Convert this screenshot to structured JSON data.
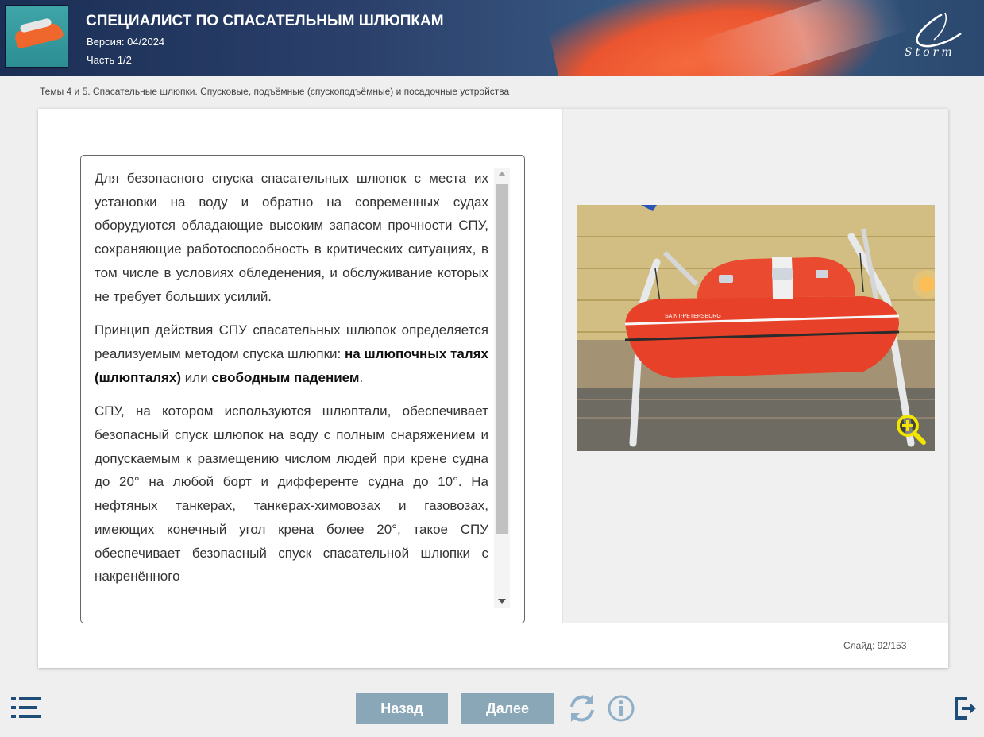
{
  "header": {
    "course_title": "СПЕЦИАЛИСТ ПО СПАСАТЕЛЬНЫМ ШЛЮПКАМ",
    "version": "Версия: 04/2024",
    "part": "Часть 1/2",
    "logo_text": "Storm"
  },
  "topic": "Темы 4 и 5. Спасательные шлюпки. Спусковые, подъёмные (спускоподъёмные) и посадочные устройства",
  "content": {
    "p1": "Для безопасного спуска спасательных шлюпок с места их установки на воду и обратно на современных судах оборудуются обладающие высоким запасом прочности СПУ, сохраняющие работоспособность в критических ситуациях, в том числе в условиях обледенения, и обслуживание которых не требует больших усилий.",
    "p2_start": "Принцип действия СПУ спасательных шлюпок определяется реализуемым методом спуска шлюпки: ",
    "p2_bold1": "на шлюпочных талях (шлюпталях)",
    "p2_mid": " или ",
    "p2_bold2": "свободным падением",
    "p2_end": ".",
    "p3": "СПУ, на котором используются шлюптали, обеспечивает безопасный спуск шлюпок на воду с полным снаряжением и допускаемым к размещению числом людей при крене судна до 20° на любой борт и дифференте судна до 10°. На нефтяных танкерах, танкерах-химовозах и газовозах, имеющих конечный угол крена более 20°, такое СПУ обеспечивает безопасный спуск спасательной шлюпки с накренённого"
  },
  "photo": {
    "boat_text": "SAINT-PETERSBURG"
  },
  "slide_counter": "Слайд: 92/153",
  "nav": {
    "back_label": "Назад",
    "next_label": "Далее"
  },
  "icons": {
    "menu": "list-menu-icon",
    "refresh": "refresh-icon",
    "info": "info-icon",
    "exit": "exit-icon",
    "zoom": "zoom-in-icon"
  },
  "colors": {
    "nav_button": "#8aa7b8",
    "zoom_accent": "#f2e600",
    "boat": "#e8412a",
    "header": "#2a3f6a"
  }
}
